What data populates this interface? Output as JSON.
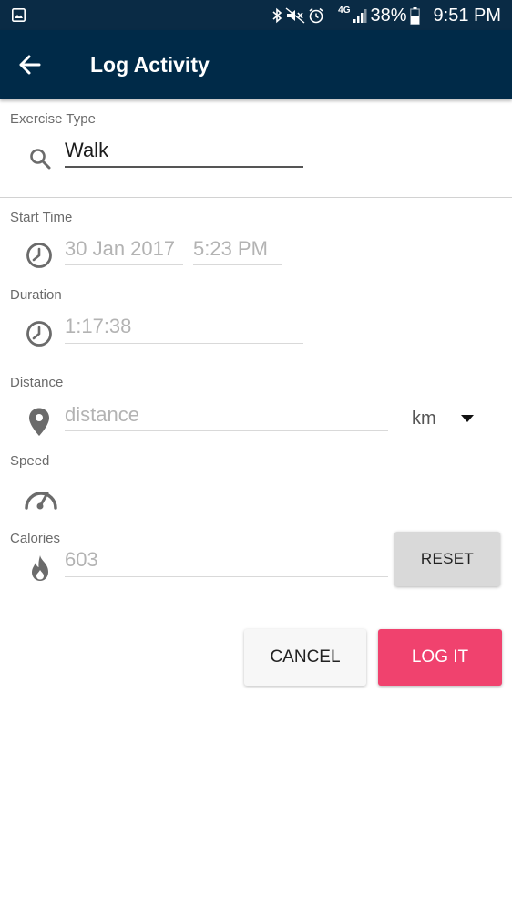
{
  "status_bar": {
    "network": "4G",
    "battery": "38%",
    "time": "9:51 PM"
  },
  "app_bar": {
    "title": "Log Activity"
  },
  "form": {
    "exercise_type": {
      "label": "Exercise Type",
      "value": "Walk"
    },
    "start_time": {
      "label": "Start Time",
      "date": "30 Jan 2017",
      "time": "5:23 PM"
    },
    "duration": {
      "label": "Duration",
      "value": "1:17:38"
    },
    "distance": {
      "label": "Distance",
      "placeholder": "distance",
      "unit": "km"
    },
    "speed": {
      "label": "Speed"
    },
    "calories": {
      "label": "Calories",
      "value": "603"
    }
  },
  "buttons": {
    "reset": "RESET",
    "cancel": "CANCEL",
    "log": "LOG IT"
  },
  "colors": {
    "app_bar": "#002a48",
    "status_bar": "#0a2b45",
    "accent": "#f0426e",
    "icon": "#6b6b6b"
  },
  "icons": [
    "image-icon",
    "bluetooth-icon",
    "mute-icon",
    "alarm-icon",
    "signal-icon",
    "battery-icon",
    "back-arrow-icon",
    "search-icon",
    "clock-icon",
    "location-pin-icon",
    "speedometer-icon",
    "flame-icon",
    "dropdown-caret-icon"
  ]
}
